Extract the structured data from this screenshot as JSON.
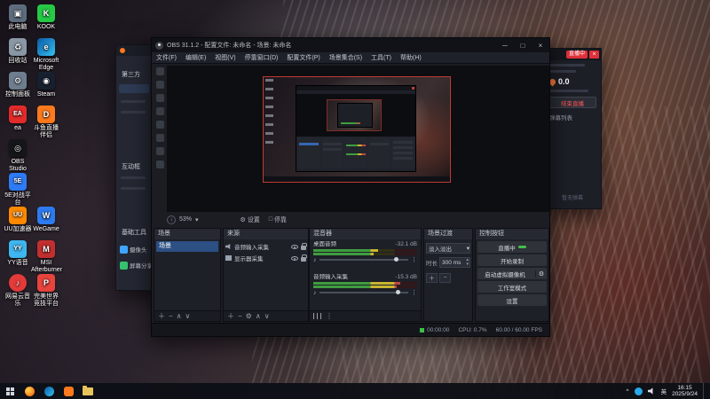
{
  "colors": {
    "selection_blue": "#2c4f84",
    "live_green": "#43c04d",
    "badge_red": "#e0313a",
    "meter_green": "#3f9d3f",
    "meter_yellow": "#c9b531",
    "meter_red": "#c24545"
  },
  "icons": {
    "chevron_down": "▾",
    "spin_up": "▴",
    "spin_down": "▾",
    "plus": "＋",
    "minus": "−",
    "up_arrow": "∧",
    "down_arrow": "∨",
    "kebab": "⋮",
    "note": "♪",
    "gear": "⚙",
    "window_min": "─",
    "window_max": "□",
    "window_close": "×",
    "tray_chevron": "^",
    "zoom_arrow": "↓"
  },
  "desktop": {
    "icons": [
      {
        "label": "此电脑",
        "glyph": "▣"
      },
      {
        "label": "KOOK",
        "glyph": "K"
      },
      {
        "label": "回收站",
        "glyph": "♻"
      },
      {
        "label": "Microsoft Edge",
        "glyph": "e"
      },
      {
        "label": "控制面板",
        "glyph": "⚙"
      },
      {
        "label": "Steam",
        "glyph": "◉"
      },
      {
        "label": "ea",
        "glyph": "EA"
      },
      {
        "label": "斗鱼直播伴侣",
        "glyph": "D"
      },
      {
        "label": "OBS Studio",
        "glyph": "◎"
      },
      {
        "label": "5E对战平台",
        "glyph": "5E"
      },
      {
        "label": "UU加速器",
        "glyph": "UU"
      },
      {
        "label": "YY语音",
        "glyph": "YY"
      },
      {
        "label": "网易云音乐",
        "glyph": "♪"
      },
      {
        "label": "WeGame",
        "glyph": "W"
      },
      {
        "label": "MSI Afterburner",
        "glyph": "M"
      },
      {
        "label": "完美世界竞技平台",
        "glyph": "P"
      }
    ]
  },
  "left_window": {
    "sections": [
      "第三方",
      "互动框",
      "基础工具"
    ],
    "tools": [
      "摄像头",
      "屏幕分享"
    ]
  },
  "right_panel": {
    "badge": "直播中",
    "heat_value": "0.0",
    "stop_button": "结束直播",
    "list_title": "弹幕列表",
    "empty_hint": "暂无弹幕"
  },
  "obs": {
    "title": "OBS 31.1.2 - 配置文件: 未命名 - 场景: 未命名",
    "menu": [
      "文件(F)",
      "编辑(E)",
      "视图(V)",
      "停靠窗口(D)",
      "配置文件(P)",
      "场景集合(S)",
      "工具(T)",
      "帮助(H)"
    ],
    "preview": {
      "zoom": "53%"
    },
    "context_bar": {
      "settings_label": "设置",
      "dock_label": "停靠"
    },
    "scenes": {
      "title": "场景",
      "items": [
        "场景"
      ]
    },
    "sources": {
      "title": "来源",
      "items": [
        "音频输入采集",
        "显示器采集"
      ]
    },
    "mixer": {
      "title": "混音器",
      "channels": [
        {
          "name": "桌面音频",
          "db": "-32.1 dB"
        },
        {
          "name": "音频输入采集",
          "db": "-15.3 dB"
        }
      ]
    },
    "transitions": {
      "title": "场景过渡",
      "transition": "淡入淡出",
      "duration_label": "时长",
      "duration_value": "300 ms"
    },
    "controls": {
      "title": "控制按钮",
      "buttons": [
        "直播中",
        "开始录制",
        "启动虚拟摄像机",
        "工作室模式",
        "设置"
      ]
    },
    "status": {
      "timer": "00:00:00",
      "cpu": "CPU: 0.7%",
      "fps": "60.00 / 60.00 FPS"
    }
  },
  "taskbar": {
    "tray": {
      "ime": "英",
      "time": "16:15",
      "date": "2025/9/24"
    }
  }
}
